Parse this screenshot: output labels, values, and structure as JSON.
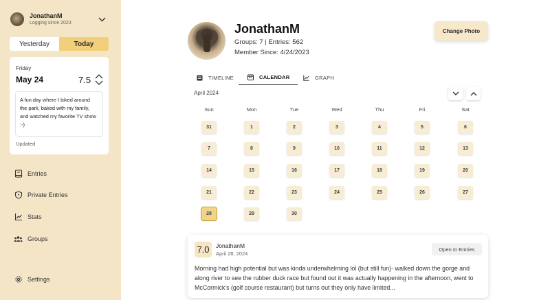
{
  "sidebar": {
    "user": {
      "name": "JonathanM",
      "subtitle": "Logging since 2023"
    },
    "toggle": {
      "yesterday": "Yesterday",
      "today": "Today",
      "selected": "Today"
    },
    "day_card": {
      "weekday": "Friday",
      "date": "May 24",
      "score": "7.5",
      "note": "A fun day where I biked around the park, baked with my family, and watched my favorite TV show :-)",
      "status": "Updated"
    },
    "nav": [
      {
        "label": "Entries",
        "icon": "book-icon"
      },
      {
        "label": "Private Entries",
        "icon": "shield-icon"
      },
      {
        "label": "Stats",
        "icon": "chart-line-icon"
      },
      {
        "label": "Groups",
        "icon": "people-icon"
      }
    ],
    "settings": {
      "label": "Settings",
      "icon": "gear-icon"
    }
  },
  "profile": {
    "name": "JonathanM",
    "meta": "Groups: 7 | Entries: 562",
    "since": "Member Since: 4/24/2023",
    "change_photo": "Change Photo"
  },
  "tabs": [
    {
      "label": "TIMELINE",
      "icon": "list-icon"
    },
    {
      "label": "CALENDAR",
      "icon": "calendar-icon"
    },
    {
      "label": "GRAPH",
      "icon": "graph-icon"
    }
  ],
  "active_tab": "CALENDAR",
  "calendar": {
    "month": "April 2024",
    "weekdays": [
      "Sun",
      "Mon",
      "Tue",
      "Wed",
      "Thu",
      "Fri",
      "Sat"
    ],
    "days": [
      "31",
      "1",
      "2",
      "3",
      "4",
      "5",
      "6",
      "7",
      "8",
      "9",
      "10",
      "11",
      "12",
      "13",
      "14",
      "15",
      "16",
      "17",
      "18",
      "19",
      "20",
      "21",
      "22",
      "23",
      "24",
      "25",
      "26",
      "27",
      "28",
      "29",
      "30"
    ],
    "selected_day": "28"
  },
  "entry": {
    "score": "7.0",
    "author": "JonathanM",
    "date": "April 28, 2024",
    "open_label": "Open In Entries",
    "text": "Morning had high potential but was kinda underwhelming lol (but still fun)- walked down the gorge and along river to see the rubber duck race but found out it was actually happening in the afternoon, went to McCormick's (golf course restaurant) but turns out they only have limited..."
  }
}
